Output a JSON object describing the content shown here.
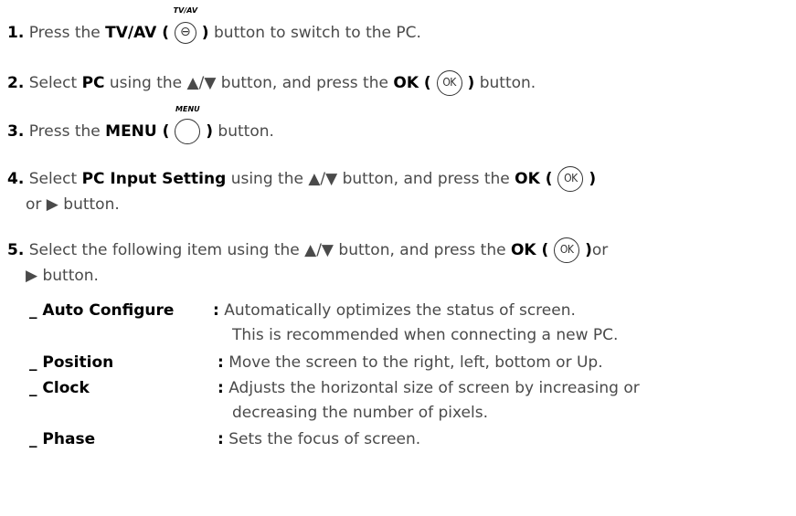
{
  "steps": [
    {
      "num": "1.",
      "pre": "Press the ",
      "bold": "TV/AV ( ",
      "bold_close": " )",
      "post": " button to switch to the PC.",
      "icon_caption": "TV/AV",
      "icon_glyph": "⊖"
    },
    {
      "num": "2.",
      "pre": "Select ",
      "bold1": "PC",
      "mid": " using the ▲/▼ button, and press the ",
      "bold2": "OK ( ",
      "icon": "OK",
      "bold2_close": " )",
      "post": " button."
    },
    {
      "num": "3.",
      "pre": "Press the ",
      "bold": "MENU ( ",
      "bold_close": " )",
      "post": " button.",
      "icon_caption": "MENU"
    },
    {
      "num": "4.",
      "pre": "Select ",
      "bold1": "PC Input Setting",
      "mid": " using the ▲/▼ button, and press the ",
      "bold2": "OK ( ",
      "icon": "OK",
      "bold2_close": " )",
      "line2": "or ▶ button."
    },
    {
      "num": "5.",
      "pre": "Select the following item using the ▲/▼ button, and press the ",
      "bold2": "OK ( ",
      "icon": "OK",
      "bold2_close": " )",
      "post": "or",
      "line2": "▶ button."
    }
  ],
  "items": [
    {
      "name": "_ Auto Configure",
      "colon": ":",
      "desc": "Automatically optimizes the status of screen.",
      "desc2": "This is recommended when connecting a new PC."
    },
    {
      "name": "_ Position",
      "colon": ":",
      "desc": "Move the screen to the right, left, bottom or Up."
    },
    {
      "name": "_ Clock",
      "colon": ":",
      "desc": "Adjusts the horizontal size of screen by increasing or",
      "desc2": "decreasing the number of pixels."
    },
    {
      "name": "_ Phase",
      "colon": ":",
      "desc": "Sets the focus of screen."
    }
  ]
}
